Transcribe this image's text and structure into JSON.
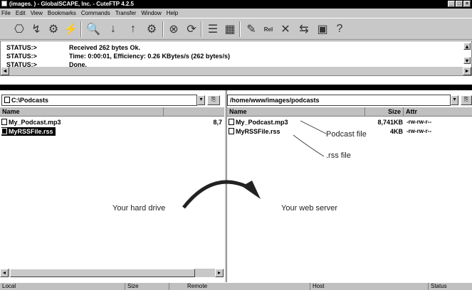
{
  "window": {
    "title": "(images.          ) - GlobalSCAPE, Inc. - CuteFTP 4.2.5",
    "controls": [
      "_",
      "□",
      "×"
    ]
  },
  "menu": [
    "File",
    "Edit",
    "View",
    "Bookmarks",
    "Commands",
    "Transfer",
    "Window",
    "Help"
  ],
  "toolbar": {
    "icons": [
      "connect-icon",
      "quick-connect-icon",
      "site-manager-icon",
      "disconnect-icon",
      "search-icon",
      "download-icon",
      "upload-icon",
      "settings-icon",
      "stop-icon",
      "refresh-icon",
      "list-view-icon",
      "detail-view-icon",
      "edit-icon",
      "rel-icon",
      "delete-icon",
      "sync-icon",
      "queue-icon",
      "help-icon"
    ],
    "rel_label": "Rel"
  },
  "status_log": [
    {
      "label": "STATUS:>",
      "text": "Received 262 bytes Ok."
    },
    {
      "label": "STATUS:>",
      "text": "Time: 0:00:01, Efficiency: 0.26 KBytes/s (262 bytes/s)"
    },
    {
      "label": "STATUS:>",
      "text": "Done."
    }
  ],
  "local": {
    "path": "C:\\Podcasts",
    "columns": {
      "name": "Name"
    },
    "files": [
      {
        "name": "My_Podcast.mp3",
        "size": "8,7",
        "selected": false
      },
      {
        "name": "MyRSSFile.rss",
        "size": "",
        "selected": true
      }
    ]
  },
  "remote": {
    "path": "/home/www/images/podcasts",
    "columns": {
      "name": "Name",
      "size": "Size",
      "attr": "Attr"
    },
    "files": [
      {
        "name": "My_Podcast.mp3",
        "size": "8,741KB",
        "attr": "-rw-rw-r--"
      },
      {
        "name": "MyRSSFile.rss",
        "size": "4KB",
        "attr": "-rw-rw-r--"
      }
    ]
  },
  "annotations": {
    "podcast_file": "Podcast file",
    "rss_file": ".rss file",
    "hard_drive": "Your hard drive",
    "web_server": "Your web server"
  },
  "bottom_bar": {
    "local": "Local",
    "size": "Size",
    "remote": "Remote",
    "host": "Host",
    "status": "Status"
  }
}
